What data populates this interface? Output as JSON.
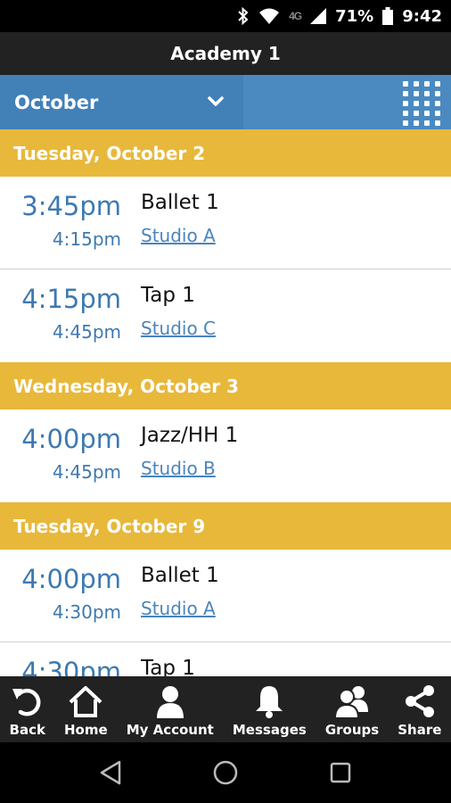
{
  "status_bar": {
    "network": "4G",
    "battery": "71%",
    "time": "9:42"
  },
  "header": {
    "title": "Academy 1"
  },
  "month_bar": {
    "selected_month": "October",
    "dropdown_icon": "chevron-down-icon",
    "view_toggle_icon": "grid-icon",
    "color": "#4a8ac1"
  },
  "schedule": [
    {
      "date": "Tuesday, October 2",
      "events": [
        {
          "start": "3:45pm",
          "end": "4:15pm",
          "class": "Ballet 1",
          "studio": "Studio A"
        },
        {
          "start": "4:15pm",
          "end": "4:45pm",
          "class": "Tap 1",
          "studio": "Studio C"
        }
      ]
    },
    {
      "date": "Wednesday, October 3",
      "events": [
        {
          "start": "4:00pm",
          "end": "4:45pm",
          "class": "Jazz/HH 1",
          "studio": "Studio B"
        }
      ]
    },
    {
      "date": "Tuesday, October 9",
      "events": [
        {
          "start": "4:00pm",
          "end": "4:30pm",
          "class": "Ballet 1",
          "studio": "Studio A"
        },
        {
          "start": "4:30pm",
          "end": "",
          "class": "Tap 1",
          "studio": ""
        }
      ]
    }
  ],
  "toolbar": {
    "items": [
      {
        "label": "Back",
        "icon": "back-icon"
      },
      {
        "label": "Home",
        "icon": "home-icon"
      },
      {
        "label": "My Account",
        "icon": "account-icon"
      },
      {
        "label": "Messages",
        "icon": "bell-icon"
      },
      {
        "label": "Groups",
        "icon": "groups-icon"
      },
      {
        "label": "Share",
        "icon": "share-icon"
      }
    ]
  },
  "colors": {
    "date_header": "#e8b83a",
    "time_text": "#3d79b1",
    "toolbar_bg": "#222222"
  }
}
